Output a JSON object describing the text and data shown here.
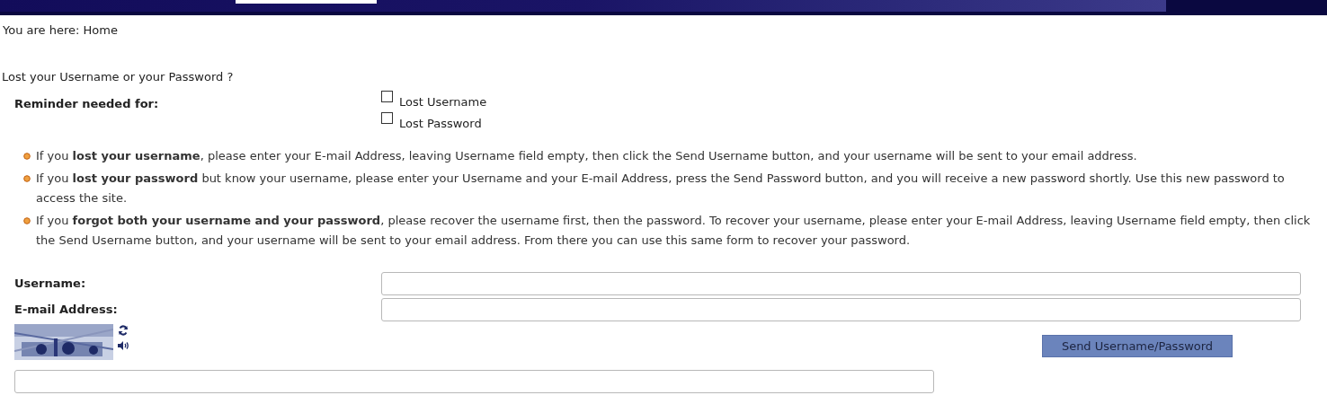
{
  "breadcrumb": "You are here: Home",
  "heading": "Lost your Username or your Password ?",
  "reminder": {
    "label": "Reminder needed for:",
    "options": [
      {
        "label": "Lost Username",
        "checked": false
      },
      {
        "label": "Lost Password",
        "checked": false
      }
    ]
  },
  "instructions": [
    "If you **lost your username**, please enter your E-mail Address, leaving Username field empty, then click the Send Username button, and your username will be sent to your email address.",
    "If you **lost your password** but know your username, please enter your Username and your E-mail Address, press the Send Password button, and you will receive a new password shortly. Use this new password to access the site.",
    "If you **forgot both your username and your password**, please recover the username first, then the password. To recover your username, please enter your E-mail Address, leaving Username field empty, then click the Send Username button, and your username will be sent to your email address. From there you can use this same form to recover your password."
  ],
  "fields": [
    {
      "label": "Username:"
    },
    {
      "label": "E-mail Address:"
    }
  ],
  "submit": "Send Username/Password"
}
